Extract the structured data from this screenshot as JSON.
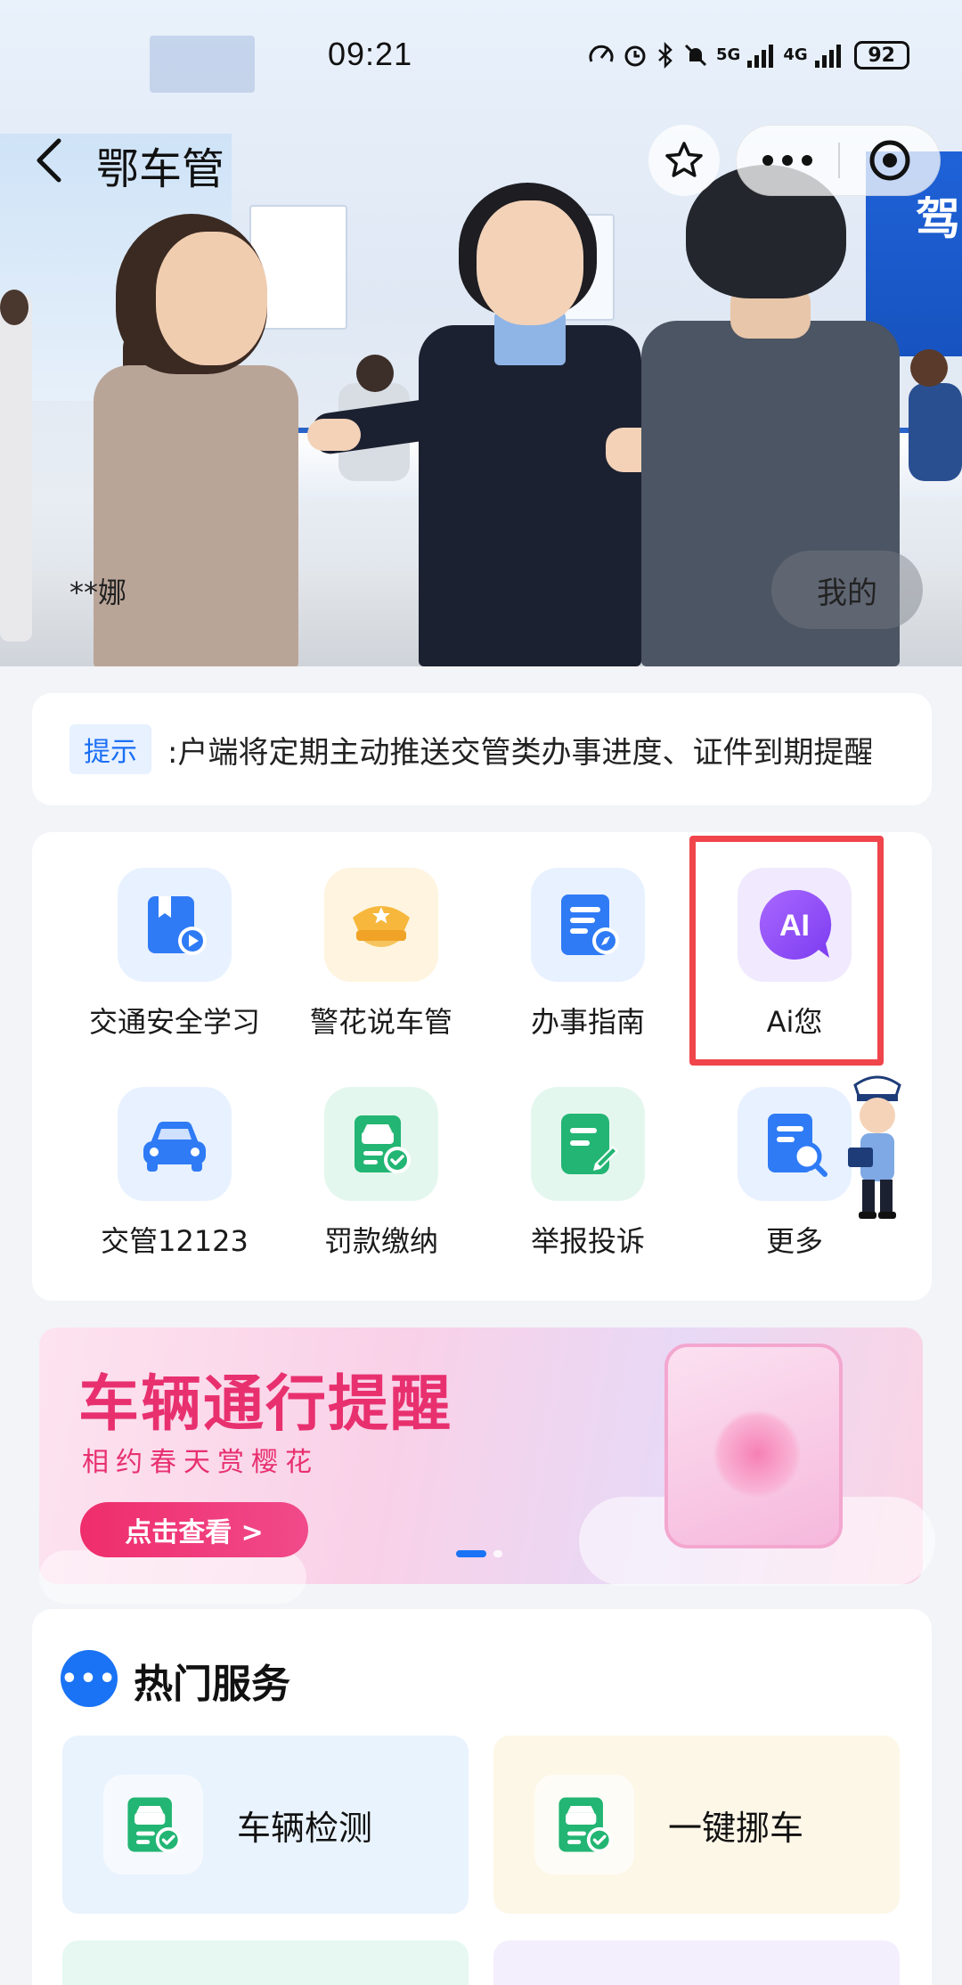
{
  "status_bar": {
    "time": "09:21",
    "network_5g": "5G",
    "network_4g": "4G",
    "battery": "92"
  },
  "nav": {
    "title": "鄂车管"
  },
  "hero": {
    "user_name": "**娜",
    "mine_label": "我的",
    "sign_text": "驾"
  },
  "notice": {
    "tag": "提示",
    "text": ":户端将定期主动推送交管类办事进度、证件到期提醒"
  },
  "grid": {
    "items": [
      {
        "label": "交通安全学习",
        "icon": "book-play-icon"
      },
      {
        "label": "警花说车管",
        "icon": "police-cap-icon"
      },
      {
        "label": "办事指南",
        "icon": "guide-doc-icon"
      },
      {
        "label": "Ai您",
        "icon": "ai-chat-icon"
      },
      {
        "label": "交管12123",
        "icon": "car-icon"
      },
      {
        "label": "罚款缴纳",
        "icon": "fine-payment-icon"
      },
      {
        "label": "举报投诉",
        "icon": "report-icon"
      },
      {
        "label": "更多",
        "icon": "more-search-icon"
      }
    ]
  },
  "banner": {
    "title": "车辆通行提醒",
    "subtitle": "相约春天赏樱花",
    "button": "点击查看 >"
  },
  "hot": {
    "title": "热门服务",
    "items": [
      {
        "label": "车辆检测",
        "icon": "vehicle-inspection-icon"
      },
      {
        "label": "一键挪车",
        "icon": "move-car-icon"
      }
    ]
  },
  "colors": {
    "primary": "#1a73f5",
    "highlight_border": "#f0454b",
    "banner_accent": "#e8306f"
  }
}
